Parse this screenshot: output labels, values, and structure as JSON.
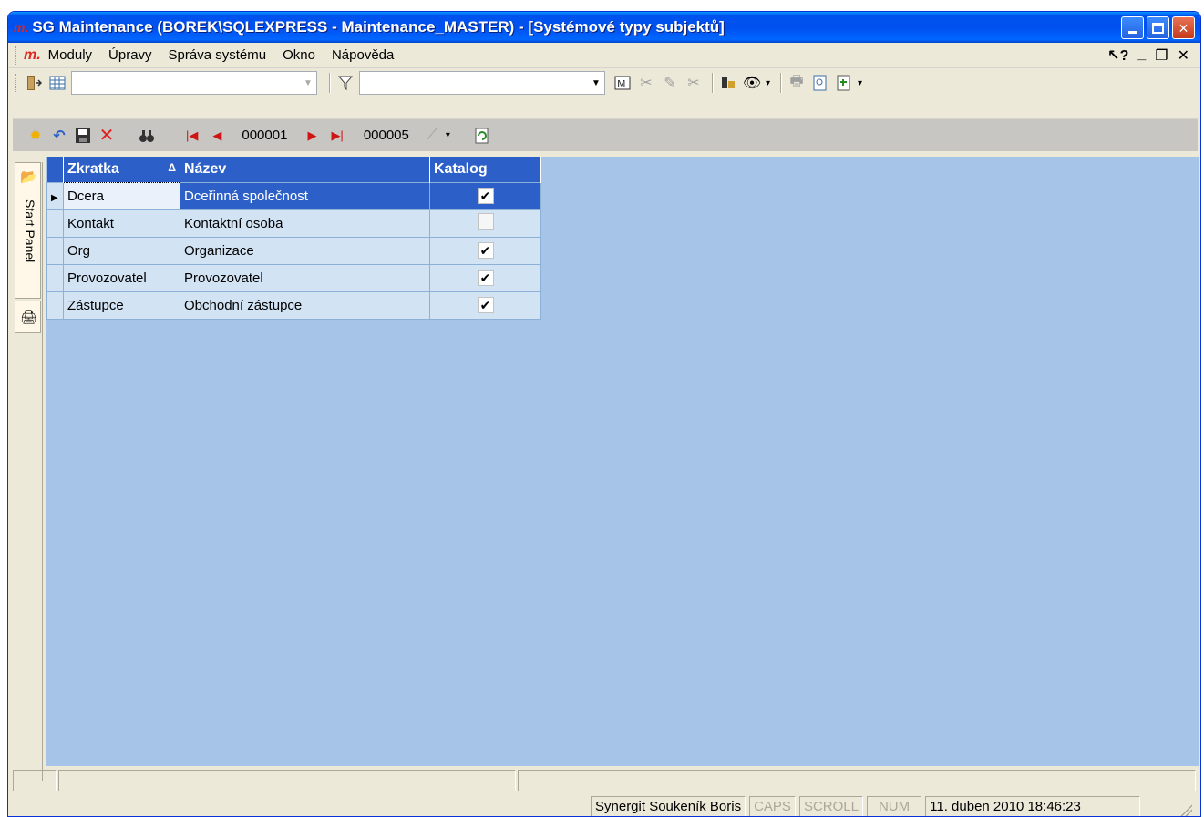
{
  "window": {
    "app_logo": "m.",
    "title": "SG Maintenance (BOREK\\SQLEXPRESS - Maintenance_MASTER) - [Systémové typy subjektů]"
  },
  "menu": {
    "logo": "m.",
    "items": [
      "Moduly",
      "Úpravy",
      "Správa systému",
      "Okno",
      "Nápověda"
    ],
    "help_icon": "?"
  },
  "toolbar1": {
    "icons": [
      "exit-icon",
      "grid-icon",
      "filter-icon",
      "export-icon",
      "eye-icon",
      "print-icon",
      "preview-icon",
      "attach-icon"
    ],
    "view_combo_value": "",
    "filter_combo_value": ""
  },
  "toolbar2": {
    "icons": [
      "new-icon",
      "undo-icon",
      "save-icon",
      "delete-icon",
      "find-icon",
      "refresh-icon"
    ],
    "current_record": "000001",
    "total_records": "000005"
  },
  "sidepanel": {
    "label": "Start Panel"
  },
  "grid": {
    "columns": [
      "Zkratka",
      "Název",
      "Katalog"
    ],
    "sort_indicator": "Δ",
    "rows": [
      {
        "zkratka": "Dcera",
        "nazev": "Dceřinná společnost",
        "katalog": true
      },
      {
        "zkratka": "Kontakt",
        "nazev": "Kontaktní osoba",
        "katalog": false
      },
      {
        "zkratka": "Org",
        "nazev": "Organizace",
        "katalog": true
      },
      {
        "zkratka": "Provozovatel",
        "nazev": "Provozovatel",
        "katalog": true
      },
      {
        "zkratka": "Zástupce",
        "nazev": "Obchodní zástupce",
        "katalog": true
      }
    ],
    "selected_row": 0
  },
  "status": {
    "user": "Synergit Soukeník Boris",
    "caps": "CAPS",
    "scroll": "SCROLL",
    "num": "NUM",
    "datetime": "11. duben 2010 18:46:23"
  },
  "colors": {
    "grid_header": "#2c60c8",
    "content_bg": "#a6c4e8",
    "cell_bg": "#d2e3f3"
  }
}
